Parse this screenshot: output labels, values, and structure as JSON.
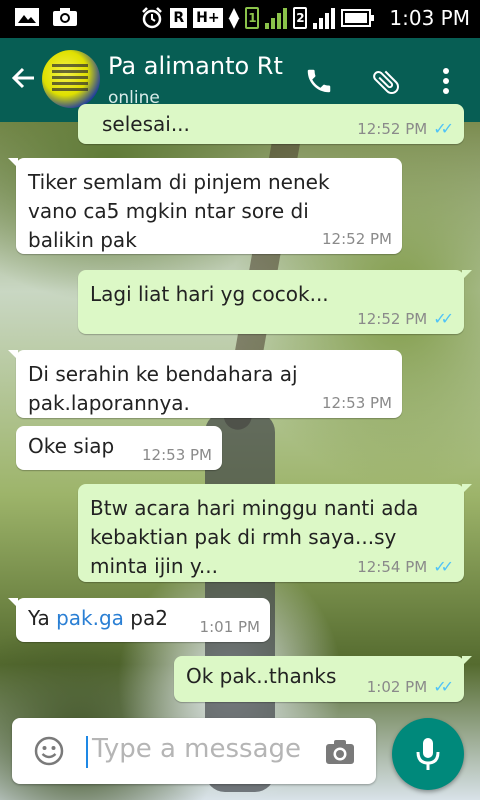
{
  "status_bar": {
    "time": "1:03 PM",
    "sim1": "1",
    "sim2": "2",
    "network_type": "H+",
    "roaming": "R"
  },
  "header": {
    "contact_name": "Pa alimanto Rt",
    "status": "online"
  },
  "messages": [
    {
      "direction": "out",
      "text": "selesai...",
      "time": "12:52 PM",
      "read": true
    },
    {
      "direction": "in",
      "text": "Tiker semlam di pinjem nenek vano ca5 mgkin ntar sore di balikin pak",
      "time": "12:52 PM"
    },
    {
      "direction": "out",
      "text": "Lagi liat hari yg cocok...",
      "time": "12:52 PM",
      "read": true
    },
    {
      "direction": "in",
      "text": "Di serahin ke bendahara aj pak.laporannya.",
      "time": "12:53 PM"
    },
    {
      "direction": "in",
      "text": "Oke siap",
      "time": "12:53 PM"
    },
    {
      "direction": "out",
      "text": "Btw acara hari minggu nanti ada kebaktian pak di rmh saya...sy minta ijin y...",
      "time": "12:54 PM",
      "read": true
    },
    {
      "direction": "in",
      "text_before": "Ya ",
      "link": "pak.ga",
      "text_after": " pa2",
      "time": "1:01 PM"
    },
    {
      "direction": "out",
      "text": "Ok pak..thanks",
      "time": "1:02 PM",
      "read": true
    }
  ],
  "composer": {
    "placeholder": "Type a message"
  },
  "icons": {
    "back": "back-arrow-icon",
    "call": "phone-icon",
    "attach": "paperclip-icon",
    "menu": "more-vert-icon",
    "emoji": "emoji-icon",
    "camera": "camera-icon",
    "mic": "mic-icon"
  },
  "colors": {
    "header": "#075e54",
    "outgoing_bubble": "#dcf8c6",
    "incoming_bubble": "#ffffff",
    "read_ticks": "#4fc3f7",
    "fab": "#00897b"
  }
}
